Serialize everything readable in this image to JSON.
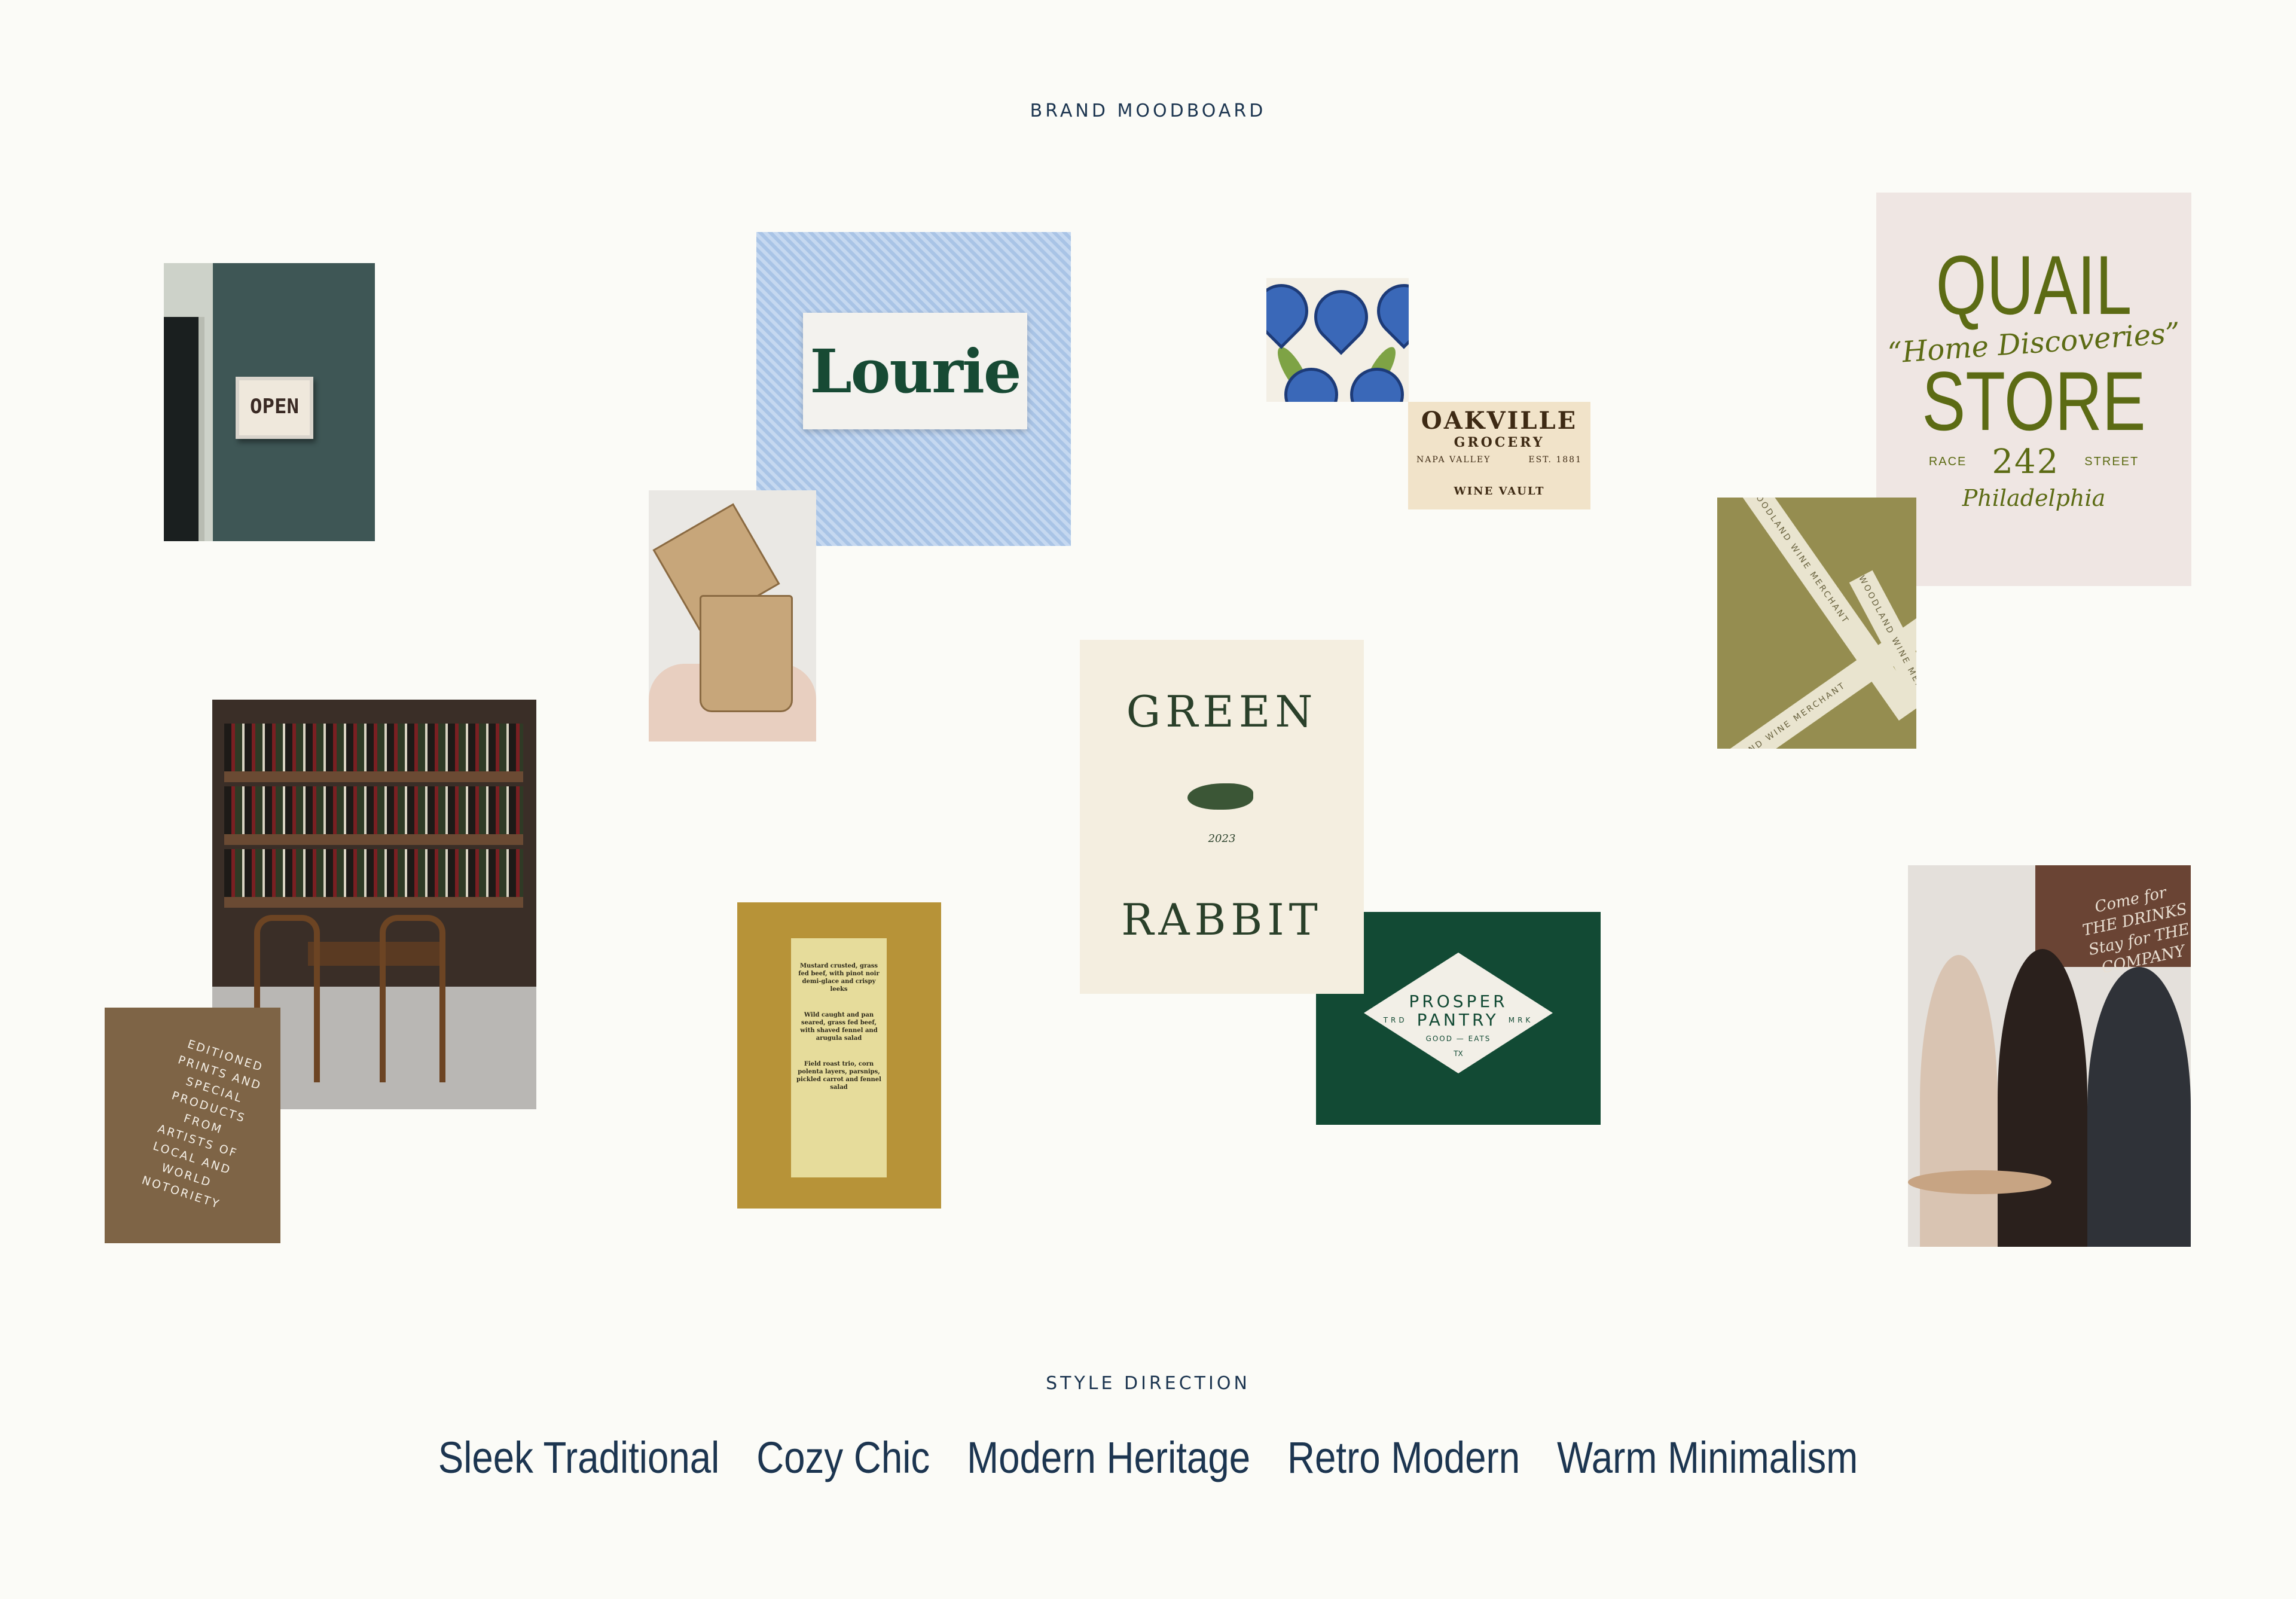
{
  "header": {
    "title": "BRAND MOODBOARD"
  },
  "tiles": {
    "open_sign": {
      "text": "OPEN"
    },
    "lourie": {
      "text": "Lourie"
    },
    "bag": {
      "text": "EDITIONED PRINTS AND SPECIAL PRODUCTS FROM ARTISTS OF LOCAL AND WORLD NOTORIETY"
    },
    "oakville": {
      "line1": "OAKVILLE",
      "line2": "GROCERY",
      "left": "NAPA VALLEY",
      "right": "EST. 1881",
      "line4": "WINE VAULT"
    },
    "quail": {
      "line1": "QUAIL",
      "tagline": "“Home Discoveries”",
      "line2": "STORE",
      "left": "RACE",
      "number": "242",
      "right": "STREET",
      "city": "Philadelphia"
    },
    "woodland": {
      "tape": "WOODLAND WINE MERCHANT"
    },
    "green_rabbit": {
      "top": "GREEN",
      "bottom": "RABBIT",
      "year": "2023"
    },
    "prosper": {
      "line1": "PROSPER",
      "left": "TRD",
      "line2": "PANTRY",
      "right": "MRK",
      "line3": "GOOD — EATS",
      "line4": "TX"
    },
    "menu": {
      "dish1": "Mustard crusted, grass fed beef, with pinot noir demi-glace and crispy leeks",
      "dish2": "Wild caught and pan seared, grass fed beef, with shaved fennel and arugula salad",
      "dish3": "Field roast trio, corn polenta layers, parsnips, pickled carrot and fennel salad"
    },
    "people_sign": {
      "text": "Come for THE DRINKS Stay for THE COMPANY"
    }
  },
  "footer": {
    "title": "STYLE DIRECTION",
    "styles": [
      "Sleek Traditional",
      "Cozy Chic",
      "Modern Heritage",
      "Retro Modern",
      "Warm Minimalism"
    ]
  },
  "colors": {
    "navy": "#1c3550",
    "forest": "#124a34",
    "olive": "#5c6b14",
    "mustard": "#b79338",
    "background": "#fbfbf7"
  }
}
